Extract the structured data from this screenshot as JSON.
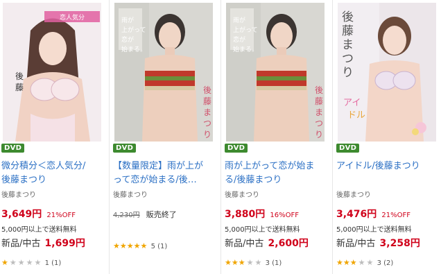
{
  "products": [
    {
      "badge": "DVD",
      "title_lines": [
        "微分積分＜恋人気分/",
        "後藤まつり"
      ],
      "artist": "後藤まつり",
      "price": "3,649円",
      "discount": "21%OFF",
      "shipping": "5,000円以上で送料無料",
      "used_label": "新品/中古",
      "used_price": "1,699円",
      "stars": 1,
      "review_count": "1 (1)",
      "cover": {
        "bg": "#e9dfe6",
        "text": "微分積分＜恋人気分",
        "side": "後藤"
      }
    },
    {
      "badge": "DVD",
      "title_lines": [
        "【数量限定】雨が上が",
        "って恋が始まる/後…"
      ],
      "artist": "後藤まつり",
      "original_price": "4,230円",
      "sold_out": "販売終了",
      "stars": 5,
      "review_count": "5 (1)",
      "cover": {
        "bg": "#d8d7d2",
        "text": "雨が上がって恋が始まる。",
        "side": "後藤まつり"
      }
    },
    {
      "badge": "DVD",
      "title_lines": [
        "雨が上がって恋が始ま",
        "る/後藤まつり"
      ],
      "artist": "後藤まつり",
      "price": "3,880円",
      "discount": "16%OFF",
      "shipping": "5,000円以上で送料無料",
      "used_label": "新品/中古",
      "used_price": "2,600円",
      "stars": 3,
      "review_count": "3 (1)",
      "cover": {
        "bg": "#d8d7d2",
        "text": "雨が上がって恋が始まる。",
        "side": "後藤まつり"
      }
    },
    {
      "badge": "DVD",
      "title_lines": [
        "アイドル/後藤まつり"
      ],
      "artist": "後藤まつり",
      "price": "3,476円",
      "discount": "21%OFF",
      "shipping": "5,000円以上で送料無料",
      "used_label": "新品/中古",
      "used_price": "3,258円",
      "stars": 3,
      "review_count": "3 (2)",
      "cover": {
        "bg": "#f2eef2",
        "text": "後藤まつり",
        "side": "アイドル"
      }
    }
  ],
  "colors": {
    "link": "#2a6fc4",
    "price": "#d0021b",
    "badge": "#3d8a2f",
    "star_on": "#f0a500",
    "star_off": "#bdbdbd"
  }
}
